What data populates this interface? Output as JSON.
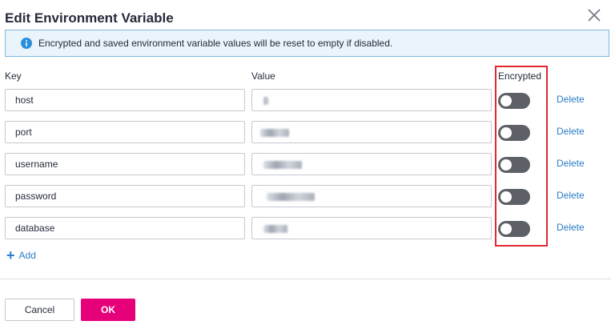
{
  "dialog": {
    "title": "Edit Environment Variable",
    "notice": "Encrypted and saved environment variable values will be reset to empty if disabled."
  },
  "columns": {
    "key": "Key",
    "value": "Value",
    "encrypted": "Encrypted"
  },
  "rows": [
    {
      "key": "host",
      "value": "",
      "encrypted": false,
      "delete_label": "Delete"
    },
    {
      "key": "port",
      "value": "",
      "encrypted": false,
      "delete_label": "Delete"
    },
    {
      "key": "username",
      "value": "",
      "encrypted": false,
      "delete_label": "Delete"
    },
    {
      "key": "password",
      "value": "",
      "encrypted": false,
      "delete_label": "Delete"
    },
    {
      "key": "database",
      "value": "",
      "encrypted": false,
      "delete_label": "Delete"
    }
  ],
  "add_label": "Add",
  "footer": {
    "cancel_label": "Cancel",
    "ok_label": "OK"
  },
  "colors": {
    "primary_button": "#e6007a",
    "link": "#2a7dc9",
    "highlight": "#e0282e",
    "toggle_off": "#5e6068",
    "notice_bg": "#eaf4fb"
  },
  "icons": {
    "close": "close-icon",
    "info": "info-icon",
    "add": "plus-icon"
  }
}
